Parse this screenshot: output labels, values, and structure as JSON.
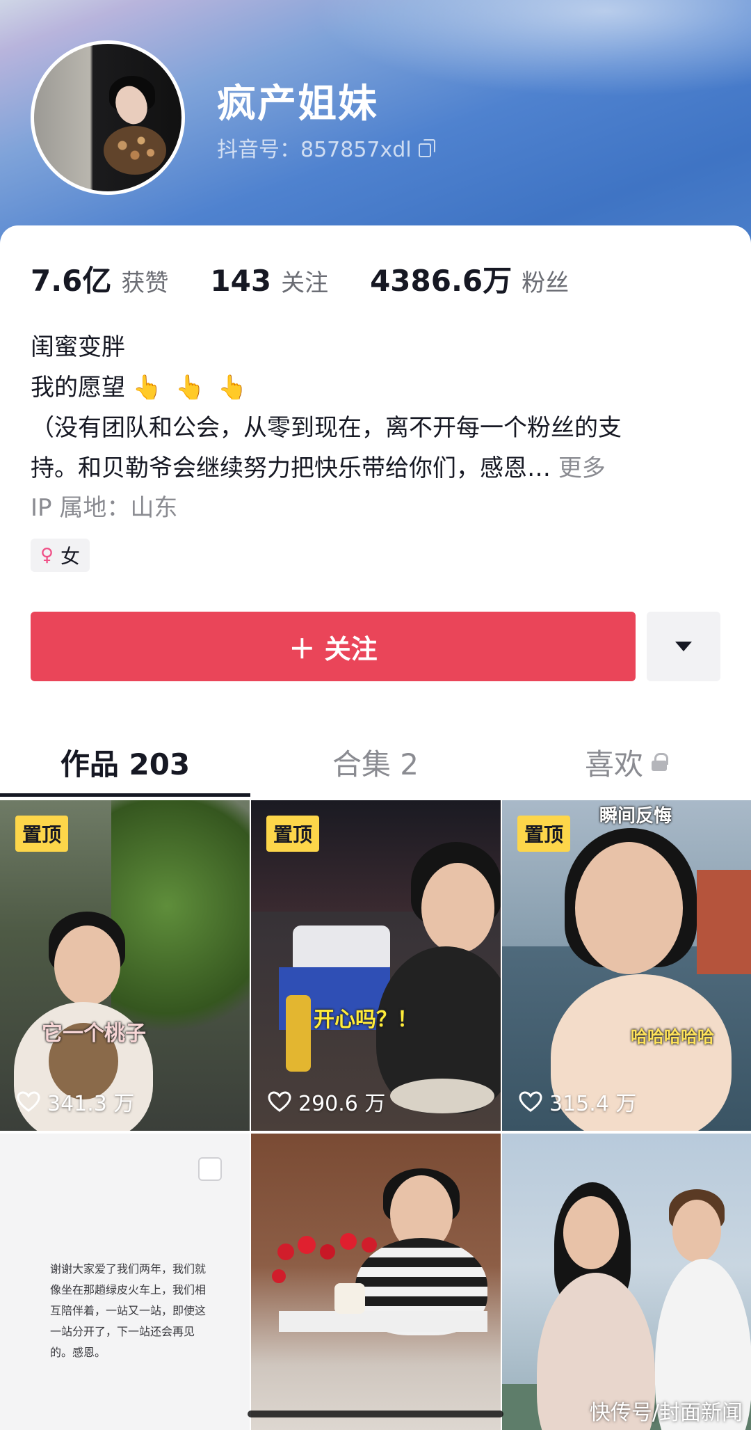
{
  "profile": {
    "nickname": "疯产姐妹",
    "douyin_id": "抖音号：857857xdl"
  },
  "stats": [
    {
      "num": "7.6亿",
      "label": "获赞"
    },
    {
      "num": "143",
      "label": "关注"
    },
    {
      "num": "4386.6万",
      "label": "粉丝"
    }
  ],
  "bio": {
    "line1": "闺蜜变胖",
    "line2": "我的愿望",
    "line2_emoji": "👆 👆 👆",
    "line3": "（没有团队和公会，从零到现在，离不开每一个粉丝的支",
    "line4": "持。和贝勒爷会继续努力把快乐带给你们，感恩…",
    "more": "更多"
  },
  "ip": "IP 属地：山东",
  "gender": {
    "icon": "♀",
    "label": "女"
  },
  "actions": {
    "follow_label": "＋ 关注"
  },
  "tabs": [
    {
      "label": "作品 203"
    },
    {
      "label": "合集 2"
    },
    {
      "label": "喜欢"
    }
  ],
  "videos": [
    {
      "pinned": "置顶",
      "likes": "341.3 万",
      "overlay": "它一个桃子"
    },
    {
      "pinned": "置顶",
      "likes": "290.6 万",
      "overlay": "开心吗？！"
    },
    {
      "pinned": "置顶",
      "likes": "315.4 万",
      "overlay_top": "瞬间反悔",
      "overlay": "哈哈哈哈哈"
    },
    {
      "note": "谢谢大家爱了我们两年，我们就像坐在那趟绿皮火车上，我们相互陪伴着，一站又一站，即使这一站分开了，下一站还会再见的。感恩。"
    },
    {},
    {}
  ],
  "watermark": "快传号/封面新闻",
  "colors": {
    "accent": "#ea4559",
    "pin": "#fdd64a",
    "gender": "#f05087"
  }
}
